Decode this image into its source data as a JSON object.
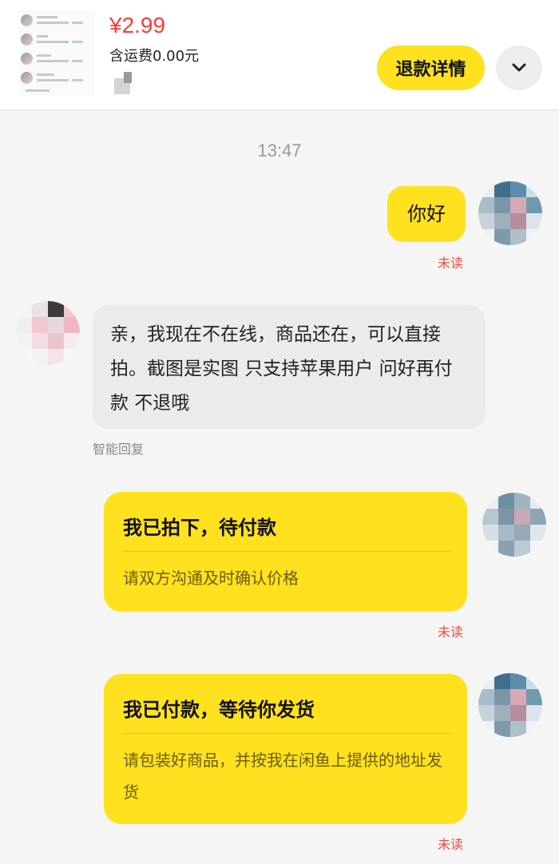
{
  "header": {
    "price": "¥2.99",
    "shipping": "含运费0.00元",
    "refund_button": "退款详情",
    "more_icon": "chevron-down-icon"
  },
  "chat": {
    "timestamp": "13:47",
    "messages": [
      {
        "side": "right",
        "type": "text",
        "text": "你好",
        "status": "未读"
      },
      {
        "side": "left",
        "type": "text",
        "text": "亲，我现在不在线，商品还在，可以直接拍。截图是实图 只支持苹果用户 问好再付款 不退哦",
        "label": "智能回复"
      },
      {
        "side": "right",
        "type": "card",
        "title": "我已拍下，待付款",
        "desc": "请双方沟通及时确认价格",
        "status": "未读"
      },
      {
        "side": "right",
        "type": "card",
        "title": "我已付款，等待你发货",
        "desc": "请包装好商品，并按我在闲鱼上提供的地址发货",
        "status": "未读"
      }
    ]
  },
  "colors": {
    "accent": "#ffe11f",
    "price": "#ff3b30",
    "unread": "#f04c3e"
  }
}
